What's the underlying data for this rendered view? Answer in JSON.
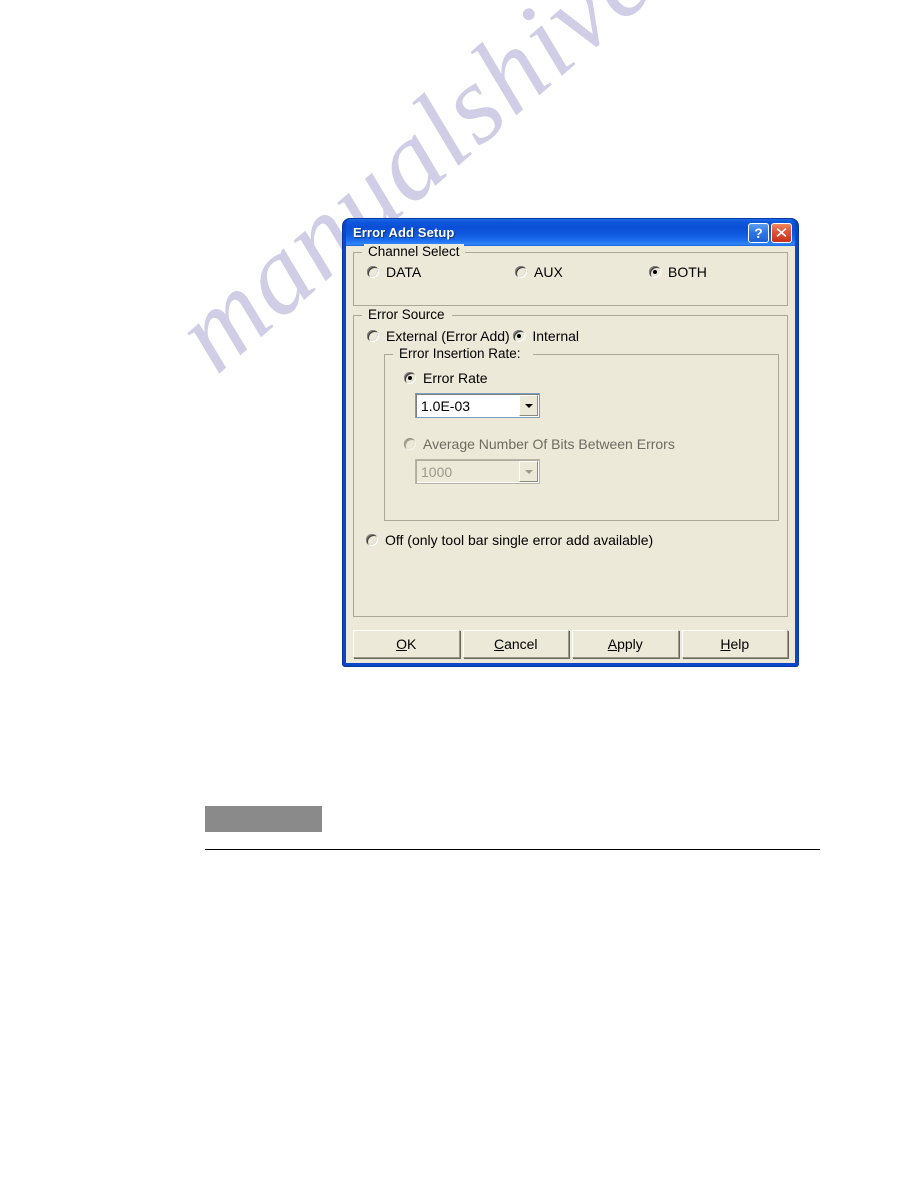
{
  "page": {
    "watermark_text": "manualshive.com",
    "background_color": "#ffffff"
  },
  "dialog": {
    "title": "Error Add Setup",
    "title_bar_color": "#0a4ed6",
    "client_color": "#ece9d8",
    "title_buttons": [
      {
        "name": "help-button",
        "glyph": "?"
      },
      {
        "name": "close-button",
        "glyph": "X"
      }
    ],
    "groups": {
      "channel_select": {
        "legend": "Channel Select",
        "options": [
          {
            "label": "DATA",
            "selected": false,
            "enabled": true
          },
          {
            "label": "AUX",
            "selected": false,
            "enabled": true
          },
          {
            "label": "BOTH",
            "selected": true,
            "enabled": true
          }
        ]
      },
      "error_source": {
        "legend": "Error Source",
        "options": [
          {
            "label": "External (Error Add)",
            "selected": false,
            "enabled": true
          },
          {
            "label": "Internal",
            "selected": true,
            "enabled": true
          }
        ],
        "error_insertion_rate": {
          "legend": "Error Insertion Rate:",
          "error_rate": {
            "label": "Error Rate",
            "selected": true,
            "enabled": true,
            "combo_value": "1.0E-03"
          },
          "average_bits": {
            "label": "Average Number Of Bits Between Errors",
            "selected": false,
            "enabled": false,
            "combo_value": "1000"
          }
        }
      }
    },
    "off_option": {
      "label_pre": "",
      "label_accel": "",
      "label": "Off (only tool bar single error add available)",
      "selected": false
    },
    "buttons": [
      {
        "name": "ok-button",
        "accel": "O",
        "rest": "K"
      },
      {
        "name": "cancel-button",
        "accel": "C",
        "rest": "ancel"
      },
      {
        "name": "apply-button",
        "accel": "A",
        "rest": "pply"
      },
      {
        "name": "help-button",
        "accel": "H",
        "rest": "elp"
      }
    ]
  }
}
